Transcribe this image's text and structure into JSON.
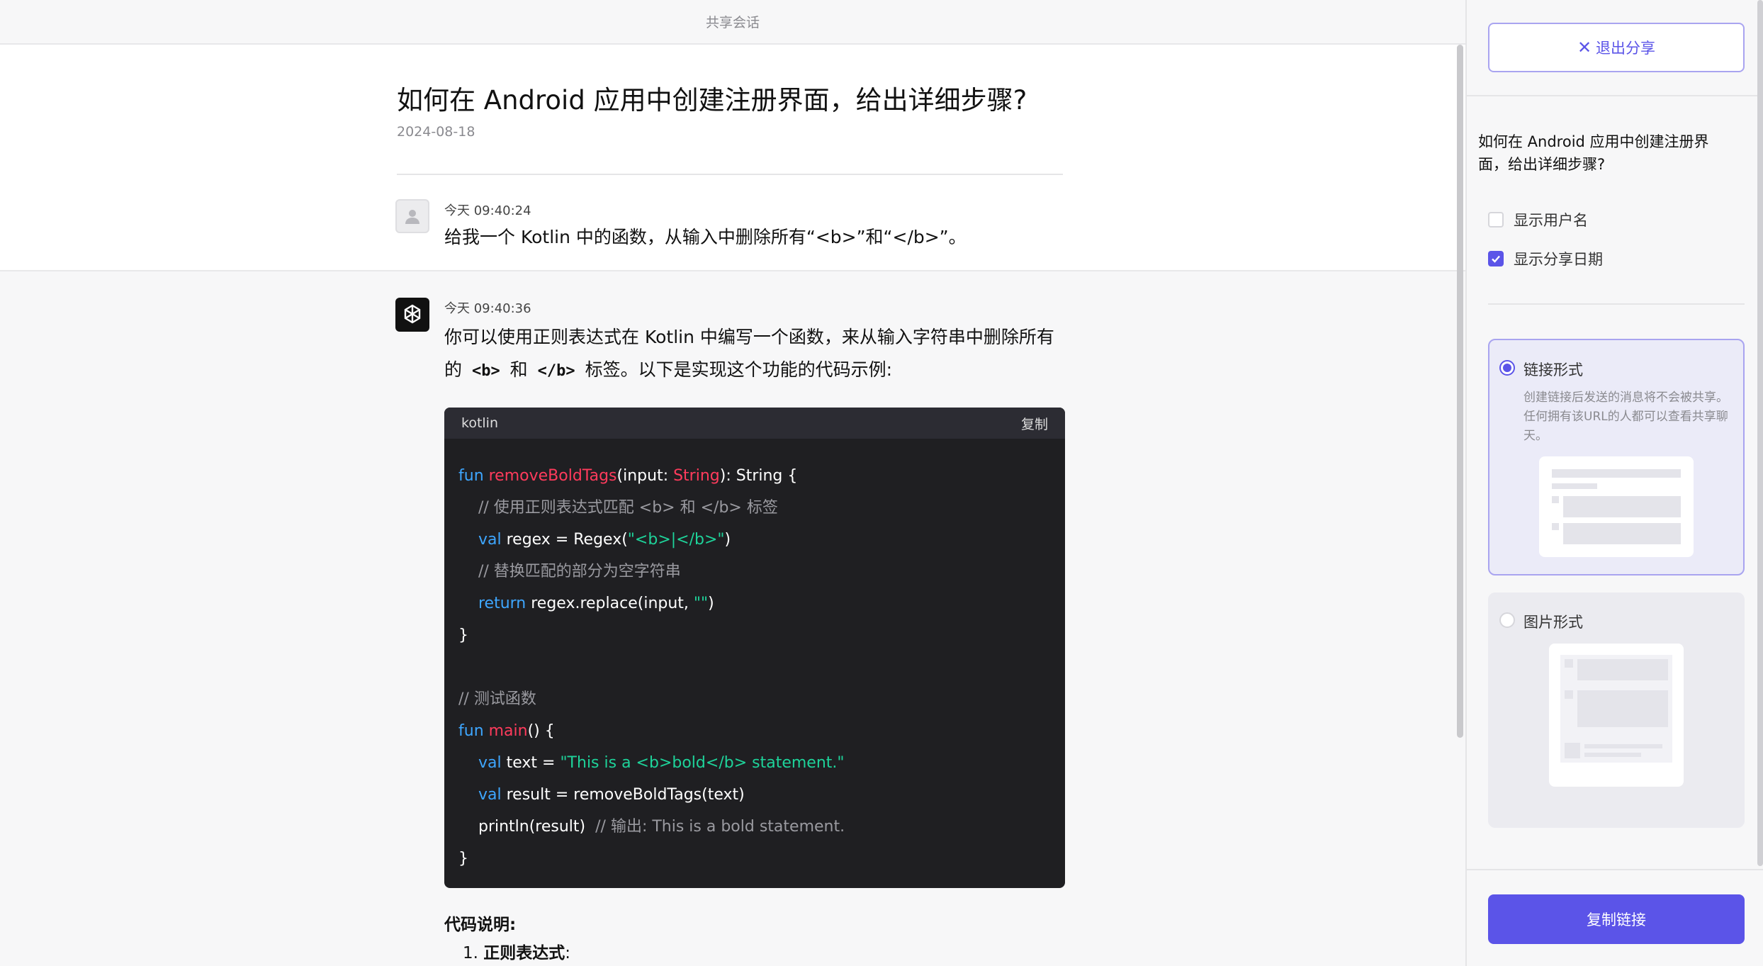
{
  "topbar": {
    "title": "共享会话"
  },
  "conversation": {
    "title": "如何在 Android 应用中创建注册界面，给出详细步骤?",
    "date": "2024-08-18"
  },
  "user_message": {
    "time": "今天 09:40:24",
    "text": "给我一个 Kotlin 中的函数，从输入中删除所有“<b>”和“</b>”。"
  },
  "bot_message": {
    "time": "今天 09:40:36",
    "para_line1": "你可以使用正则表达式在 Kotlin 中编写一个函数，来从输入字符串中删除所有",
    "para_line2_pre": "的",
    "para_code1": "<b>",
    "para_mid": "和",
    "para_code2": "</b>",
    "para_line2_post": "标签。以下是实现这个功能的代码示例:",
    "code_lang": "kotlin",
    "code_copy": "复制",
    "code": {
      "l1_kw": "fun ",
      "l1_fn": "removeBoldTags",
      "l1_a": "(input: ",
      "l1_ty": "String",
      "l1_b": "): String {",
      "l2": "    // 使用正则表达式匹配 <b> 和 </b> 标签",
      "l3_kw": "    val ",
      "l3_a": "regex = Regex(",
      "l3_str": "\"<b>|</b>\"",
      "l3_b": ")",
      "l4": "    // 替换匹配的部分为空字符串",
      "l5_kw": "    return ",
      "l5_a": "regex.replace(input, ",
      "l5_str": "\"\"",
      "l5_b": ")",
      "l6": "}",
      "l8": "// 测试函数",
      "l9_kw": "fun ",
      "l9_fn": "main",
      "l9_b": "() {",
      "l10_kw": "    val ",
      "l10_a": "text = ",
      "l10_str": "\"This is a <b>bold</b> statement.\"",
      "l11_kw": "    val ",
      "l11_a": "result = removeBoldTags(text)",
      "l12_a": "    println(result)  ",
      "l12_cm": "// 输出: This is a bold statement.",
      "l13": "}"
    },
    "explanation_title": "代码说明:",
    "explanation_item_num": "1.",
    "explanation_item_bold": "正则表达式",
    "explanation_item_rest": ":"
  },
  "panel": {
    "exit_label": "退出分享",
    "title": "如何在 Android 应用中创建注册界面，给出详细步骤?",
    "show_username": "显示用户名",
    "show_share_date": "显示分享日期",
    "show_username_checked": false,
    "show_share_date_checked": true,
    "option_link_label": "链接形式",
    "option_link_desc": "创建链接后发送的消息将不会被共享。任何拥有该URL的人都可以查看共享聊天。",
    "option_image_label": "图片形式",
    "selected_option": "link",
    "copy_link_label": "复制链接",
    "accent_color": "#5b54e8"
  }
}
